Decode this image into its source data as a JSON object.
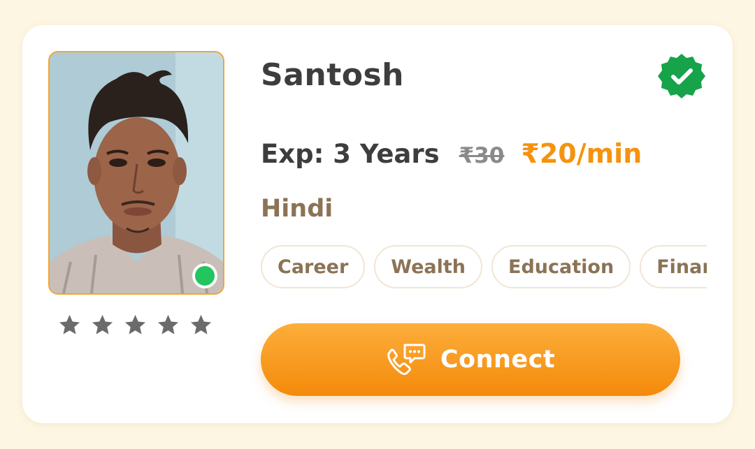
{
  "astrologer": {
    "name": "Santosh",
    "experience": "Exp: 3 Years",
    "old_price": "₹30",
    "price": "₹20/min",
    "language": "Hindi",
    "online": true,
    "verified": true,
    "rating_stars": 5
  },
  "tags": [
    "Career",
    "Wealth",
    "Education",
    "Finance"
  ],
  "connect": {
    "label": "Connect"
  },
  "colors": {
    "accent": "#f5930f",
    "online": "#22c55e",
    "verified": "#16a34a",
    "star": "#6b6b6b"
  },
  "icons": {
    "verified": "verified-badge-icon",
    "online": "online-status-dot",
    "star": "star-icon",
    "connect": "phone-chat-icon"
  }
}
